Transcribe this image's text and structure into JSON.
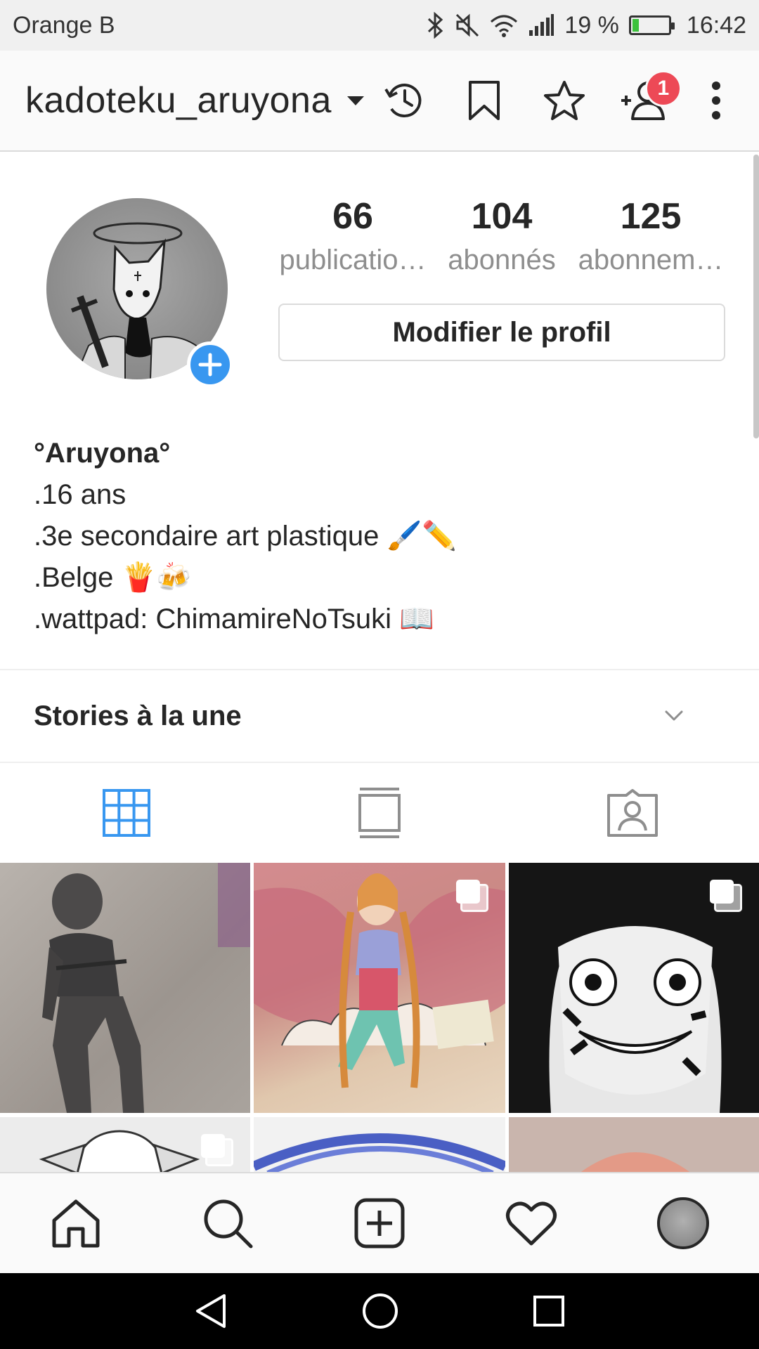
{
  "status_bar": {
    "carrier": "Orange B",
    "battery_percent": "19 %",
    "battery_level": 0.19,
    "time": "16:42",
    "icons": [
      "bluetooth-icon",
      "mute-icon",
      "wifi-icon",
      "signal-icon",
      "battery-icon"
    ]
  },
  "app_bar": {
    "username": "kadoteku_aruyona",
    "notification_count": "1",
    "icons": [
      "archive-icon",
      "bookmark-icon",
      "star-icon",
      "add-user-icon",
      "more-icon"
    ]
  },
  "profile": {
    "stats": [
      {
        "value": "66",
        "label": "publicatio…"
      },
      {
        "value": "104",
        "label": "abonnés"
      },
      {
        "value": "125",
        "label": "abonnem…"
      }
    ],
    "edit_button": "Modifier le profil",
    "bio": {
      "name": "°Aruyona°",
      "lines": [
        ".16 ans",
        ".3e secondaire art plastique 🖌️✏️",
        ".Belge 🍟🍻",
        ".wattpad: ChimamireNoTsuki 📖"
      ]
    }
  },
  "highlights": {
    "title": "Stories à la une"
  },
  "tabs": [
    "grid-icon",
    "feed-icon",
    "tagged-icon"
  ],
  "colors": {
    "accent": "#3897f0",
    "badge": "#ed4956",
    "text": "#262626",
    "muted": "#8e8e8e"
  },
  "bottom_nav": [
    "home-icon",
    "search-icon",
    "new-post-icon",
    "activity-icon",
    "profile-avatar"
  ],
  "system_nav": [
    "back-icon",
    "home-circle-icon",
    "recents-icon"
  ]
}
